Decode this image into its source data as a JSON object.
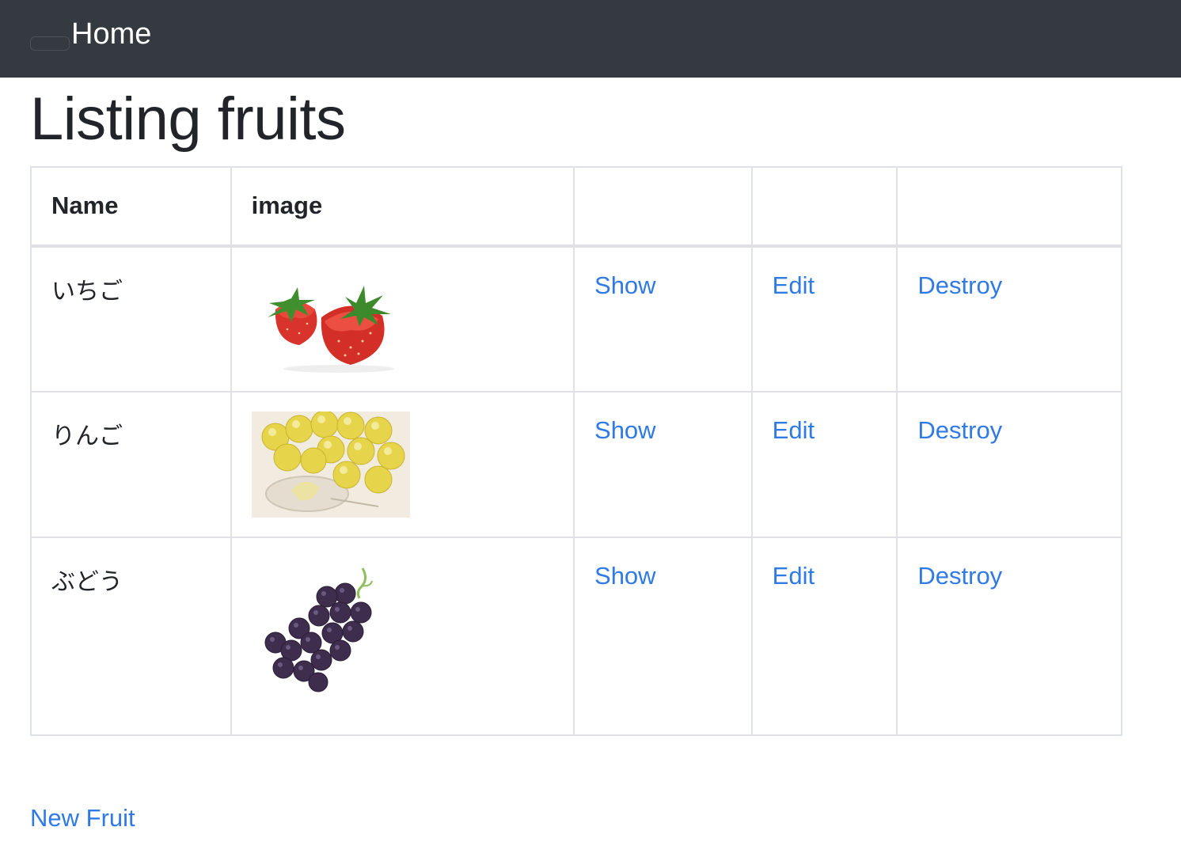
{
  "navbar": {
    "brand": "Home"
  },
  "page": {
    "title": "Listing fruits"
  },
  "table": {
    "headers": [
      "Name",
      "image",
      "",
      "",
      ""
    ],
    "rows": [
      {
        "name": "いちご",
        "image": "strawberry-image",
        "show": "Show",
        "edit": "Edit",
        "destroy": "Destroy"
      },
      {
        "name": "りんご",
        "image": "apple-image",
        "show": "Show",
        "edit": "Edit",
        "destroy": "Destroy"
      },
      {
        "name": "ぶどう",
        "image": "grape-image",
        "show": "Show",
        "edit": "Edit",
        "destroy": "Destroy"
      }
    ]
  },
  "actions": {
    "new_fruit": "New Fruit"
  },
  "colors": {
    "navbar_bg": "#343a40",
    "link": "#2f7ae5",
    "border": "#dee2e6"
  }
}
